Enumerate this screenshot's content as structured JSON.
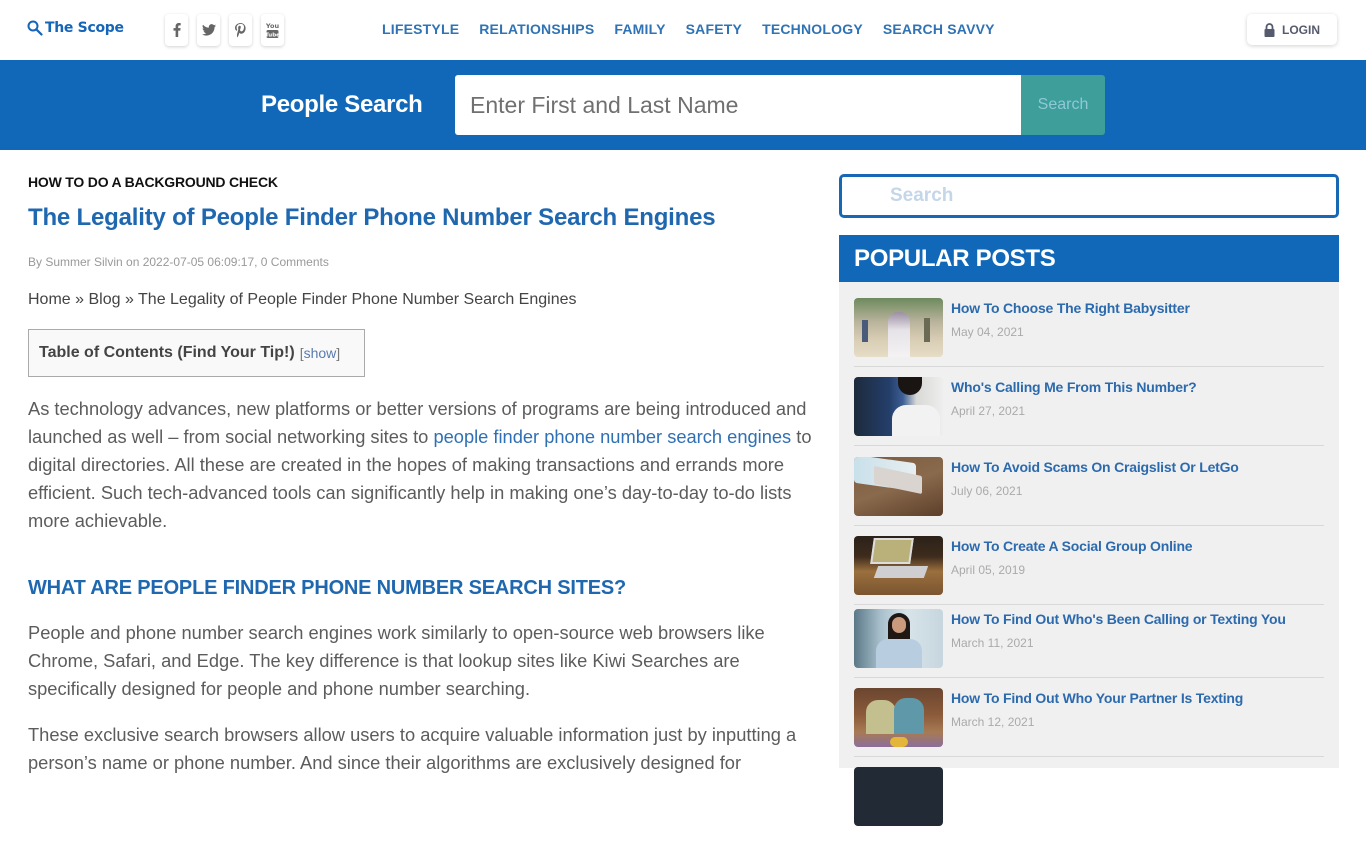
{
  "header": {
    "logo_text": "The Scope",
    "socials": [
      {
        "name": "facebook",
        "glyph": "f"
      },
      {
        "name": "twitter",
        "glyph": "t"
      },
      {
        "name": "pinterest",
        "glyph": "p"
      },
      {
        "name": "youtube",
        "glyph": "You Tube"
      }
    ],
    "nav": [
      "LIFESTYLE",
      "RELATIONSHIPS",
      "FAMILY",
      "SAFETY",
      "TECHNOLOGY",
      "SEARCH SAVVY"
    ],
    "login_label": "LOGIN"
  },
  "people_search": {
    "title": "People Search",
    "placeholder": "Enter First and Last Name",
    "button_label": "Search"
  },
  "article": {
    "category": "HOW TO DO A BACKGROUND CHECK",
    "title": "The Legality of People Finder Phone Number Search Engines",
    "byline": "By Summer Silvin on 2022-07-05 06:09:17, 0 Comments",
    "breadcrumb": {
      "home": "Home",
      "sep": " » ",
      "blog": "Blog",
      "current": "The Legality of People Finder Phone Number Search Engines"
    },
    "toc": {
      "title": "Table of Contents (Find Your Tip!)",
      "show": "show"
    },
    "p1_before": "As technology advances, new platforms or better versions of programs are being introduced and launched as well – from social networking sites to ",
    "p1_link": "people finder phone number search engines",
    "p1_after": " to digital directories. All these are created in the hopes of making transactions and errands more efficient. Such tech-advanced tools can significantly help in making one’s day-to-day to-do lists more achievable.",
    "h2": "WHAT ARE PEOPLE FINDER PHONE NUMBER SEARCH SITES?",
    "p2": "People and phone number search engines work similarly to open-source web browsers like Chrome, Safari, and Edge. The key difference is that lookup sites like Kiwi Searches are specifically designed for people and phone number searching.",
    "p3": "These exclusive search browsers allow users to acquire valuable information just by inputting a person’s name or phone number. And since their algorithms are exclusively designed for"
  },
  "sidebar": {
    "search_placeholder": "Search",
    "popular_title": "POPULAR POSTS",
    "posts": [
      {
        "title": "How To Choose The Right Babysitter",
        "date": "May 04, 2021"
      },
      {
        "title": "Who's Calling Me From This Number?",
        "date": "April 27, 2021"
      },
      {
        "title": "How To Avoid Scams On Craigslist Or LetGo",
        "date": "July 06, 2021"
      },
      {
        "title": "How To Create A Social Group Online",
        "date": "April 05, 2019"
      },
      {
        "title": "How To Find Out Who's Been Calling or Texting You",
        "date": "March 11, 2021"
      },
      {
        "title": "How To Find Out Who Your Partner Is Texting",
        "date": "March 12, 2021"
      }
    ]
  },
  "colors": {
    "brand_blue": "#1268b8",
    "link_blue": "#2f73b5",
    "search_button": "#3d9e9a"
  }
}
